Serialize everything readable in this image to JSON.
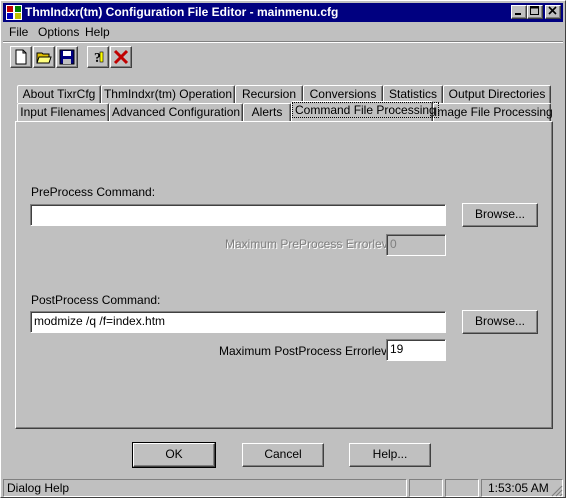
{
  "window": {
    "title": "ThmIndxr(tm) Configuration File Editor - mainmenu.cfg"
  },
  "menu": [
    {
      "label": "File"
    },
    {
      "label": "Options"
    },
    {
      "label": "Help"
    }
  ],
  "toolbar": {
    "icons": [
      "new-file-icon",
      "open-folder-icon",
      "save-disk-icon",
      "help-question-icon",
      "close-x-icon"
    ]
  },
  "tabs_row1": [
    {
      "label": "About TixrCfg"
    },
    {
      "label": "ThmIndxr(tm) Operation"
    },
    {
      "label": "Recursion"
    },
    {
      "label": "Conversions"
    },
    {
      "label": "Statistics"
    },
    {
      "label": "Output Directories"
    }
  ],
  "tabs_row2": [
    {
      "label": "Input Filenames"
    },
    {
      "label": "Advanced Configuration"
    },
    {
      "label": "Alerts"
    },
    {
      "label": "Command File Processing",
      "active": true
    },
    {
      "label": "Image File Processing"
    }
  ],
  "preprocess": {
    "label": "PreProcess Command:",
    "value": "",
    "browse_label": "Browse...",
    "errorlevel_label": "Maximum PreProcess Errorlevel:",
    "errorlevel_value": "0"
  },
  "postprocess": {
    "label": "PostProcess Command:",
    "value": "modmize /q /f=index.htm",
    "browse_label": "Browse...",
    "errorlevel_label": "Maximum PostProcess Errorlevel:",
    "errorlevel_value": "19"
  },
  "buttons": {
    "ok": "OK",
    "cancel": "Cancel",
    "help": "Help..."
  },
  "status": {
    "text": "Dialog Help",
    "time": "1:53:05 AM"
  },
  "colors": {
    "titlebar": "#000080",
    "face": "#c0c0c0",
    "close_icon": "#c00000"
  }
}
